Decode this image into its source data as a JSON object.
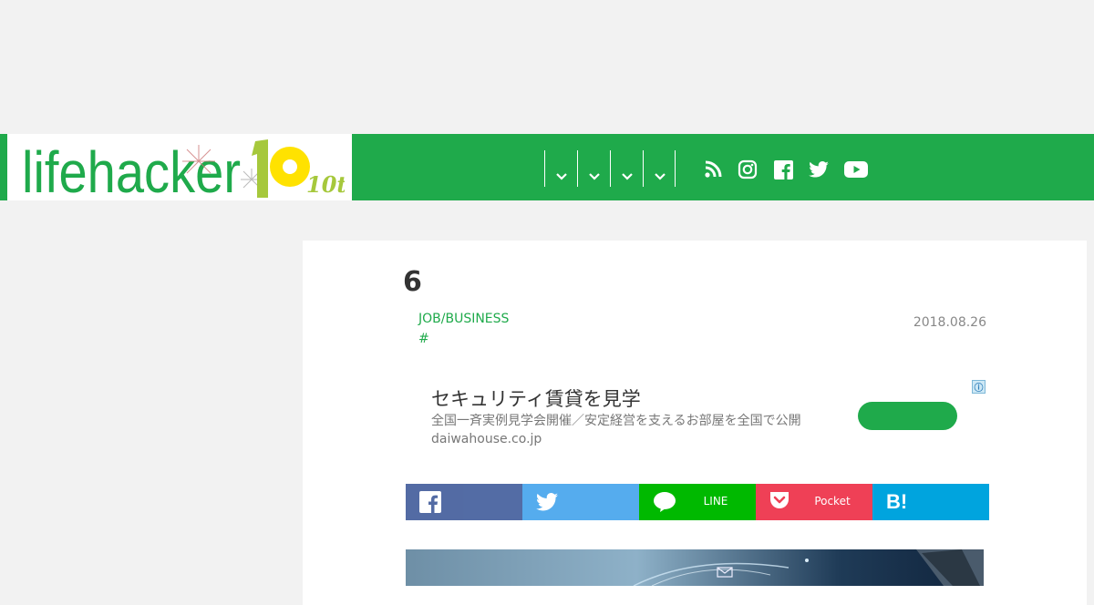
{
  "header": {
    "logo_text": "lifehacker",
    "logo_anniversary": "10th",
    "nav_dropdowns": [
      {
        "label": "",
        "icon": "chevron-down-icon"
      },
      {
        "label": "",
        "icon": "chevron-down-icon"
      },
      {
        "label": "",
        "icon": "chevron-down-icon"
      },
      {
        "label": "",
        "icon": "chevron-down-icon"
      }
    ],
    "social_icons": [
      "rss-icon",
      "instagram-icon",
      "facebook-icon",
      "twitter-icon",
      "youtube-icon"
    ]
  },
  "article": {
    "title": "6",
    "category": "JOB/BUSINESS",
    "hashtag": "#",
    "date": "2018.08.26"
  },
  "ad": {
    "info_icon": "ⓘ",
    "headline": "セキュリティ賃貸を見学",
    "description": "全国一斉実例見学会開催／安定経営を支えるお部屋を全国で公開 daiwahouse.co.jp",
    "cta": ""
  },
  "share": {
    "facebook": "",
    "twitter": "",
    "line": "LINE",
    "pocket": "Pocket",
    "hatena": ""
  },
  "colors": {
    "brand_green": "#1faa4b",
    "page_bg": "#f2f2f2",
    "facebook": "#4a64a0",
    "twitter": "#55acee",
    "line": "#00b900",
    "pocket": "#ef4056",
    "hatena": "#00a4de"
  }
}
